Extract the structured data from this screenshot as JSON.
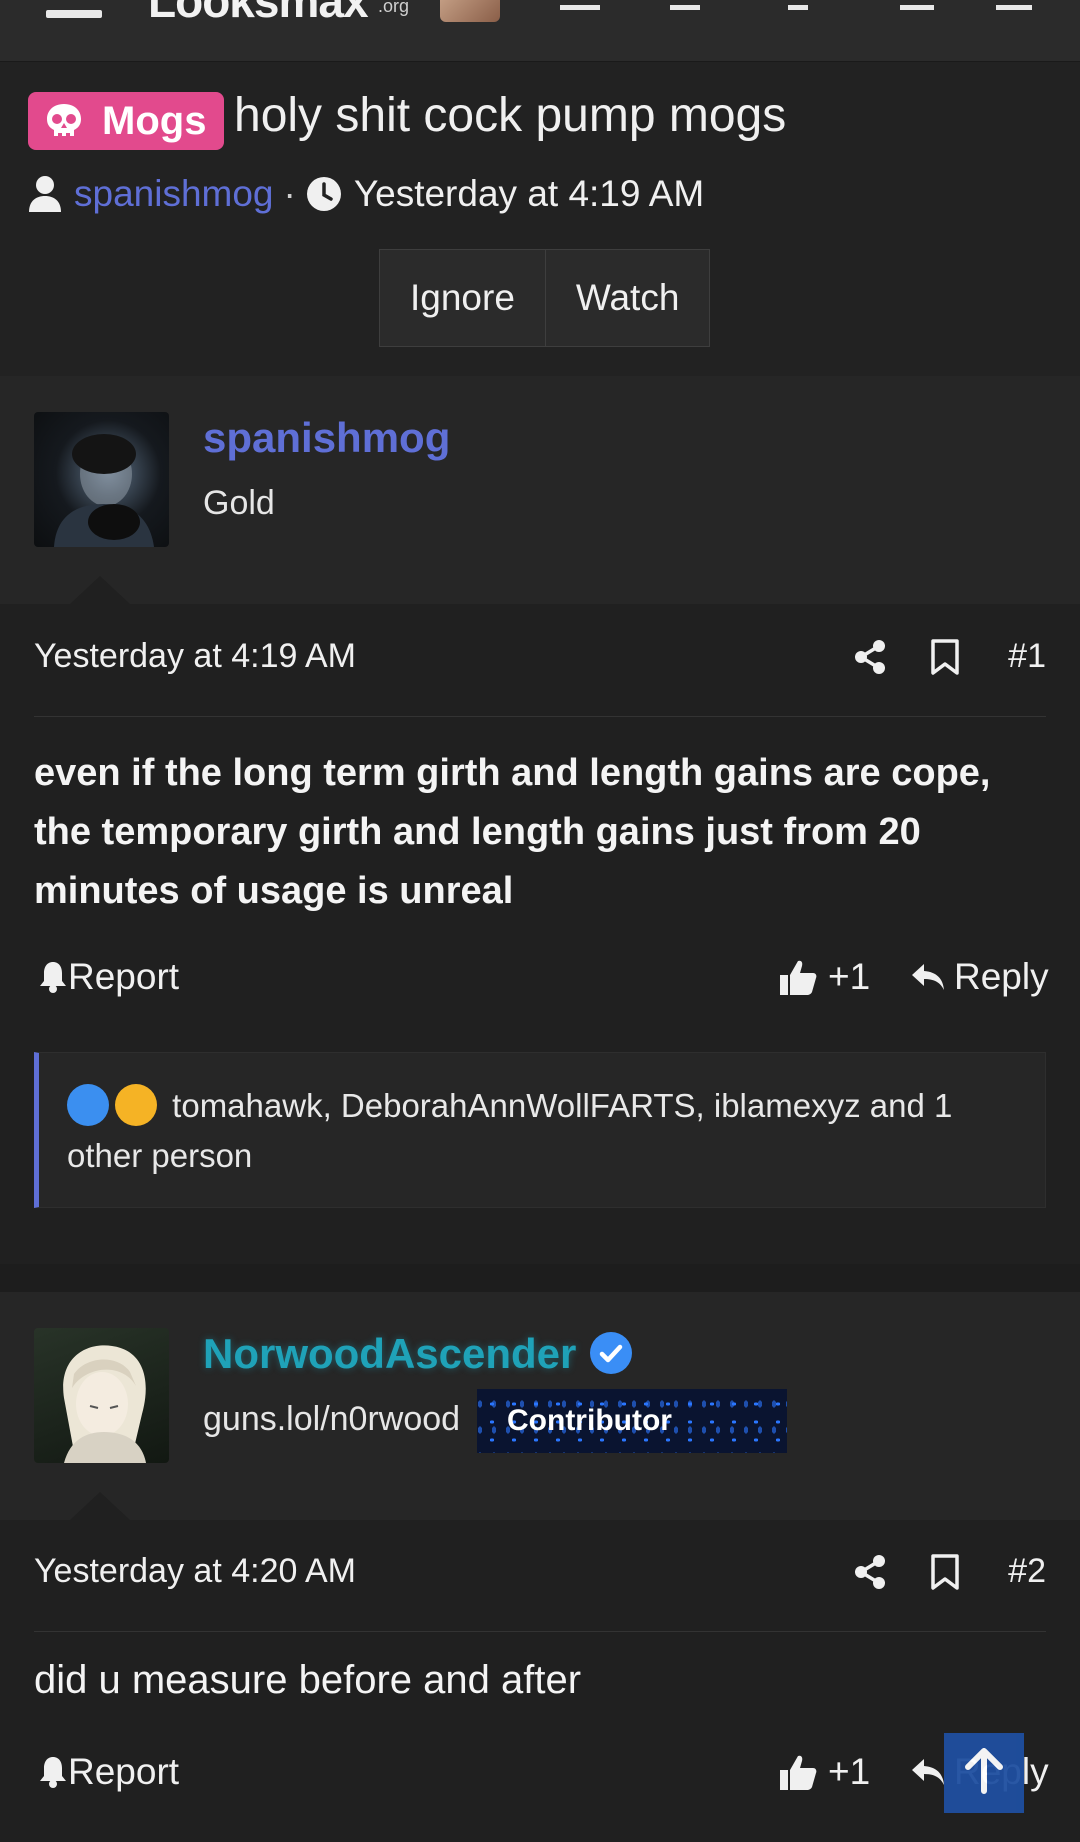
{
  "header": {
    "logo_text": "Looksmax",
    "logo_suffix": ".org"
  },
  "thread": {
    "prefix": "Mogs",
    "title": "holy shit cock pump mogs",
    "author": "spanishmog",
    "separator": "·",
    "time": "Yesterday at 4:19 AM",
    "buttons": {
      "ignore": "Ignore",
      "watch": "Watch"
    }
  },
  "posts": [
    {
      "username": "spanishmog",
      "user_title": "Gold",
      "date": "Yesterday at 4:19 AM",
      "number": "#1",
      "body": "even if the long term girth and length gains are cope, the temporary girth and length gains just from 20 minutes of usage is unreal",
      "report": "Report",
      "like_count": "+1",
      "reply": "Reply",
      "reactions": "tomahawk, DeborahAnnWollFARTS, iblamexyz and 1 other person"
    },
    {
      "username": "NorwoodAscender",
      "user_title": "guns.lol/n0rwood",
      "banner": "Contributor",
      "date": "Yesterday at 4:20 AM",
      "number": "#2",
      "body": "did u measure before and after",
      "report": "Report",
      "like_count": "+1",
      "reply": "Reply"
    }
  ],
  "colors": {
    "background": "#222222",
    "prefix": "#e24a8d",
    "link": "#5f6fd6",
    "username_teal": "#1fa2b8",
    "verified": "#3a8ef6"
  }
}
